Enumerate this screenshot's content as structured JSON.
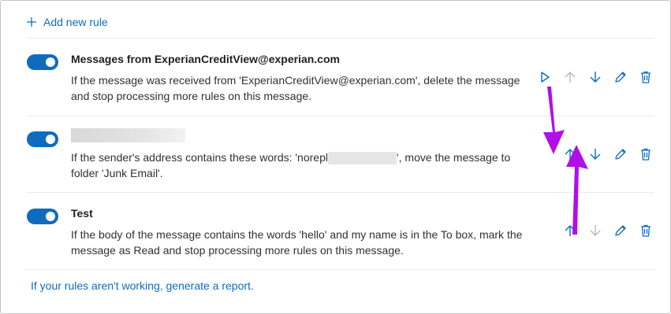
{
  "add_rule": {
    "label": "Add new rule",
    "icon": "plus-icon"
  },
  "rules": [
    {
      "enabled": true,
      "title": "Messages from ExperianCreditView@experian.com",
      "description": "If the message was received from 'ExperianCreditView@experian.com', delete the message and stop processing more rules on this message."
    },
    {
      "enabled": true,
      "title": "",
      "description_prefix": "If the sender's address contains these words: 'norepl",
      "description_suffix": "', move the message to folder 'Junk Email'."
    },
    {
      "enabled": true,
      "title": "Test",
      "description": "If the body of the message contains the words 'hello' and my name is in the To box, mark the message as Read and stop processing more rules on this message."
    }
  ],
  "action_icons": [
    "run-icon",
    "arrow-up-icon",
    "arrow-down-icon",
    "pencil-icon",
    "trash-icon"
  ],
  "footer": {
    "link_text": "If your rules aren't working, generate a report."
  },
  "colors": {
    "accent": "#0f6cbd",
    "annotation_arrow": "#b10ee8",
    "disabled_icon": "#b8b8b8"
  }
}
